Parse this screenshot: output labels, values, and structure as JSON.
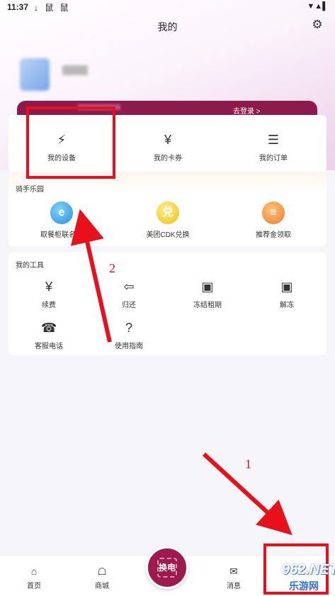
{
  "status_bar": {
    "time": "11:37",
    "left_icons": "↓ 鼠 鼠",
    "right_icons": "▼▲▌"
  },
  "header": {
    "title": "我的"
  },
  "profile": {
    "username": "用户"
  },
  "banner": {
    "left_text": "",
    "right_text": "去登录 >"
  },
  "top_grid": [
    {
      "label": "我的设备",
      "icon": "battery-icon",
      "glyph": "⚡"
    },
    {
      "label": "我的卡券",
      "icon": "coupon-icon",
      "glyph": "¥"
    },
    {
      "label": "我的订单",
      "icon": "clipboard-icon",
      "glyph": "☰"
    }
  ],
  "fun_section": {
    "title": "骑手乐园",
    "items": [
      {
        "label": "取餐柜联名卡",
        "icon": "e-logo-icon",
        "glyph": "e",
        "color": "#3aa3e8"
      },
      {
        "label": "美团CDK兑换",
        "icon": "exchange-icon",
        "glyph": "兑",
        "color": "#f2c21a"
      },
      {
        "label": "推荐金领取",
        "icon": "coins-icon",
        "glyph": "≡",
        "color": "#f08a3a"
      }
    ]
  },
  "tools_section": {
    "title": "我的工具",
    "items": [
      {
        "label": "续费",
        "icon": "renew-icon",
        "glyph": "¥"
      },
      {
        "label": "归还",
        "icon": "return-icon",
        "glyph": "⇦"
      },
      {
        "label": "冻结租期",
        "icon": "lock-icon",
        "glyph": "▣"
      },
      {
        "label": "解冻",
        "icon": "unlock-icon",
        "glyph": "▣"
      },
      {
        "label": "客服电话",
        "icon": "headset-icon",
        "glyph": "☎"
      },
      {
        "label": "使用指南",
        "icon": "help-icon",
        "glyph": "?"
      }
    ]
  },
  "bottom_nav": {
    "tabs": [
      {
        "label": "首页",
        "icon": "home-icon",
        "glyph": "⌂"
      },
      {
        "label": "商城",
        "icon": "shop-icon",
        "glyph": "☖"
      },
      {
        "label": "消息",
        "icon": "message-icon",
        "glyph": "✉"
      }
    ],
    "center_button": "换电"
  },
  "annotations": {
    "label_1": "1",
    "label_2": "2"
  },
  "watermark": {
    "line1": "962.NET",
    "line2": "乐游网"
  },
  "colors": {
    "brand": "#9d1a4f",
    "annotation": "#e8101a"
  }
}
